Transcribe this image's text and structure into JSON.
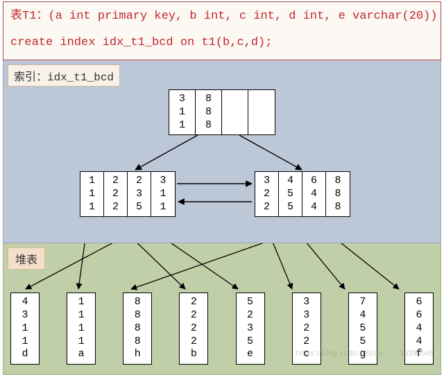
{
  "header": {
    "line1": "表T1：(a int primary key, b int, c int, d int, e varchar(20))",
    "line2": "create index idx_t1_bcd on t1(b,c,d);"
  },
  "index": {
    "label": "索引：idx_t1_bcd",
    "root": {
      "cols": [
        [
          "3",
          "1",
          "1"
        ],
        [
          "8",
          "8",
          "8"
        ],
        [
          " ",
          " ",
          " "
        ],
        [
          " ",
          " ",
          " "
        ]
      ]
    },
    "leaf_left": {
      "cols": [
        [
          "1",
          "1",
          "1"
        ],
        [
          "2",
          "2",
          "2"
        ],
        [
          "2",
          "3",
          "5"
        ],
        [
          "3",
          "1",
          "1"
        ]
      ]
    },
    "leaf_right": {
      "cols": [
        [
          "3",
          "2",
          "2"
        ],
        [
          "4",
          "5",
          "5"
        ],
        [
          "6",
          "4",
          "4"
        ],
        [
          "8",
          "8",
          "8"
        ]
      ]
    }
  },
  "heap": {
    "label": "堆表",
    "rows": [
      {
        "cols": [
          [
            "4",
            "3",
            "1",
            "1",
            "d"
          ]
        ]
      },
      {
        "cols": [
          [
            "1",
            "1",
            "1",
            "1",
            "a"
          ]
        ]
      },
      {
        "cols": [
          [
            "8",
            "8",
            "8",
            "8",
            "h"
          ]
        ]
      },
      {
        "cols": [
          [
            "2",
            "2",
            "2",
            "2",
            "b"
          ]
        ]
      },
      {
        "cols": [
          [
            "5",
            "2",
            "3",
            "5",
            "e"
          ]
        ]
      },
      {
        "cols": [
          [
            "3",
            "3",
            "2",
            "2",
            "c"
          ]
        ]
      },
      {
        "cols": [
          [
            "7",
            "4",
            "5",
            "5",
            "g"
          ]
        ]
      },
      {
        "cols": [
          [
            "6",
            "6",
            "4",
            "4",
            "f"
          ]
        ]
      }
    ]
  },
  "chart_data": {
    "type": "table",
    "description": "B+-tree composite index idx_t1_bcd on (b,c,d) over heap table T1(a,b,c,d,e)",
    "index_root_keys_bcd": [
      [
        3,
        1,
        1
      ],
      [
        8,
        8,
        8
      ]
    ],
    "index_leaf_keys_bcd": [
      [
        1,
        1,
        1
      ],
      [
        2,
        2,
        2
      ],
      [
        2,
        3,
        5
      ],
      [
        3,
        1,
        1
      ],
      [
        3,
        2,
        2
      ],
      [
        4,
        5,
        5
      ],
      [
        6,
        4,
        4
      ],
      [
        8,
        8,
        8
      ]
    ],
    "heap_rows_abcde": [
      [
        4,
        3,
        1,
        1,
        "d"
      ],
      [
        1,
        1,
        1,
        1,
        "a"
      ],
      [
        8,
        8,
        8,
        8,
        "h"
      ],
      [
        2,
        2,
        2,
        2,
        "b"
      ],
      [
        5,
        2,
        3,
        5,
        "e"
      ],
      [
        3,
        3,
        2,
        2,
        "c"
      ],
      [
        7,
        4,
        5,
        5,
        "g"
      ],
      [
        6,
        6,
        4,
        4,
        "f"
      ]
    ],
    "leaf_to_heap_pointer": {
      "111": "a",
      "222": "b",
      "235": "e",
      "311": "d",
      "322": "c",
      "455": "g",
      "644": "f",
      "888": "h"
    }
  },
  "watermark": {
    "a": "https://blog.csdn.net/qq_",
    "b": "39390545"
  }
}
